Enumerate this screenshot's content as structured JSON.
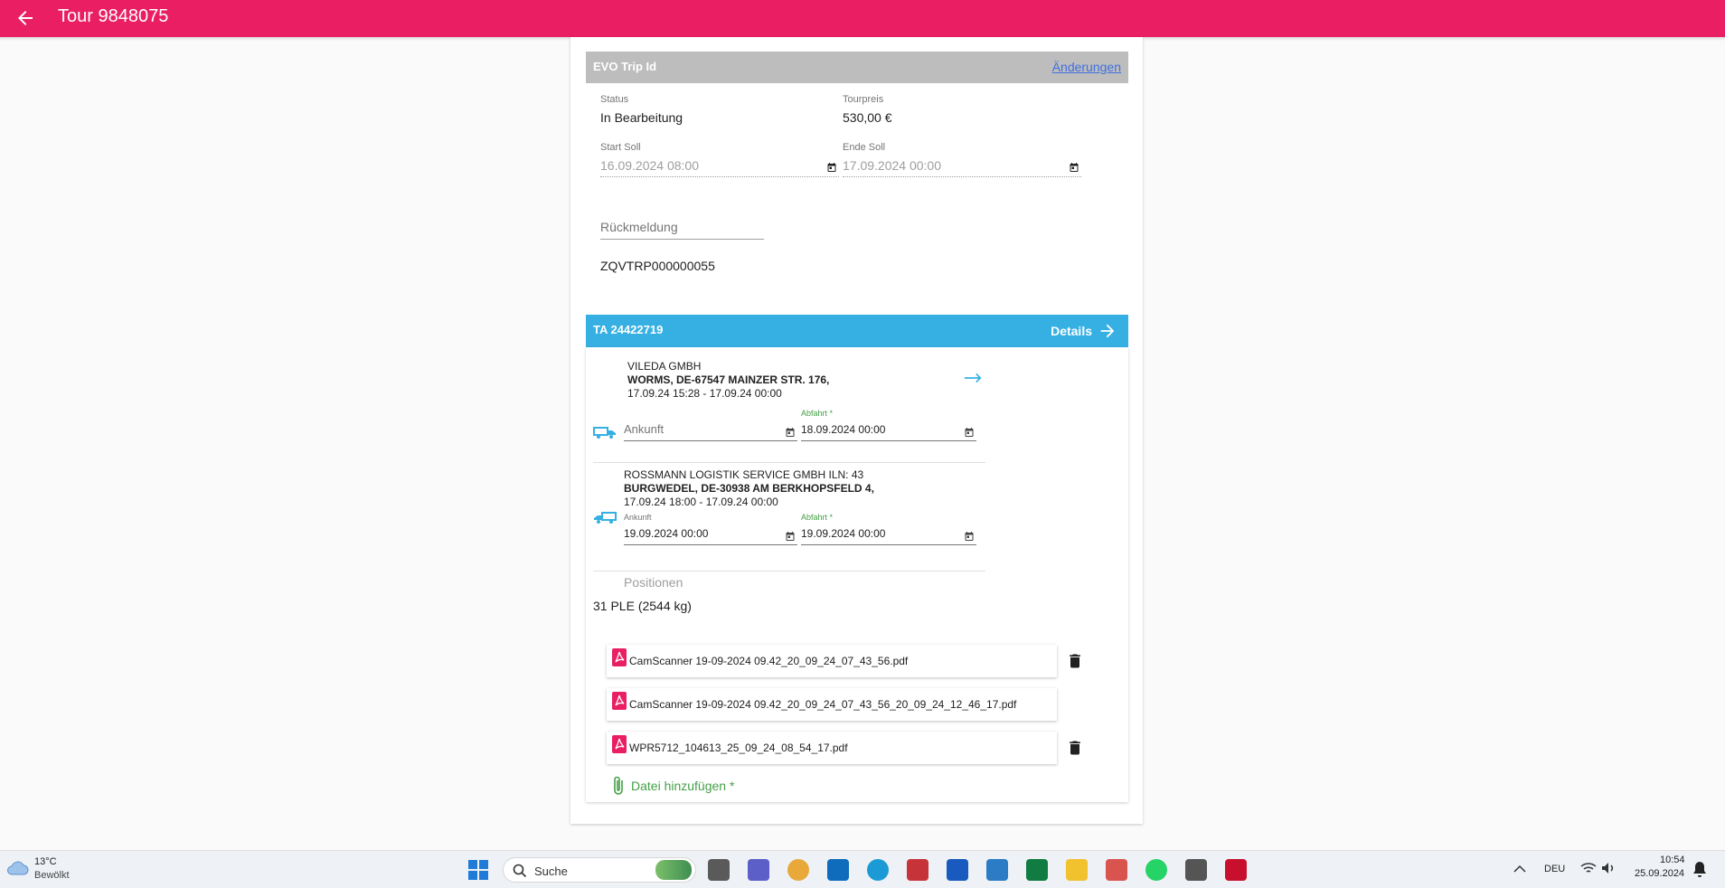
{
  "appbar": {
    "title": "Tour 9848075"
  },
  "evo": {
    "header_label": "EVO Trip Id",
    "changes_link": "Änderungen",
    "status_label": "Status",
    "status_value": "In Bearbeitung",
    "price_label": "Tourpreis",
    "price_value": "530,00 €",
    "start_label": "Start Soll",
    "start_value": "16.09.2024 08:00",
    "end_label": "Ende Soll",
    "end_value": "17.09.2024 00:00",
    "feedback_placeholder": "Rückmeldung",
    "trip_code": "ZQVTRP000000055"
  },
  "ta": {
    "header_label": "TA 24422719",
    "details_label": "Details",
    "stops": [
      {
        "company": "VILEDA GMBH",
        "address": "WORMS, DE-67547 MAINZER STR. 176,",
        "window": "17.09.24 15:28 - 17.09.24 00:00",
        "arrival_placeholder": "Ankunft",
        "departure_label": "Abfahrt *",
        "departure_value": "18.09.2024 00:00"
      },
      {
        "company": "ROSSMANN LOGISTIK SERVICE GMBH ILN: 43",
        "address": "BURGWEDEL, DE-30938 AM BERKHOPSFELD 4,",
        "window": "17.09.24 18:00 - 17.09.24 00:00",
        "arrival_label": "Ankunft",
        "arrival_value": "19.09.2024 00:00",
        "departure_label": "Abfahrt *",
        "departure_value": "19.09.2024 00:00"
      }
    ],
    "positions_label": "Positionen",
    "positions_value": "31 PLE (2544 kg)",
    "files": [
      {
        "name": "CamScanner 19-09-2024 09.42_20_09_24_07_43_56.pdf",
        "deletable": true
      },
      {
        "name": "CamScanner 19-09-2024 09.42_20_09_24_07_43_56_20_09_24_12_46_17.pdf",
        "deletable": false
      },
      {
        "name": "WPR5712_104613_25_09_24_08_54_17.pdf",
        "deletable": true
      }
    ],
    "add_file_label": "Datei hinzufügen *"
  },
  "taskbar": {
    "weather_temp": "13°C",
    "weather_desc": "Bewölkt",
    "search_label": "Suche",
    "language": "DEU",
    "time": "10:54",
    "date": "25.09.2024"
  },
  "colors": {
    "primary": "#e91e63",
    "accent_blue": "#36b0e3",
    "link": "#3f6fe0",
    "success_green": "#43a047"
  },
  "icons": [
    "back-arrow-icon",
    "calendar-icon",
    "arrow-right-icon",
    "truck-icon",
    "pdf-icon",
    "trash-icon",
    "paperclip-icon"
  ]
}
